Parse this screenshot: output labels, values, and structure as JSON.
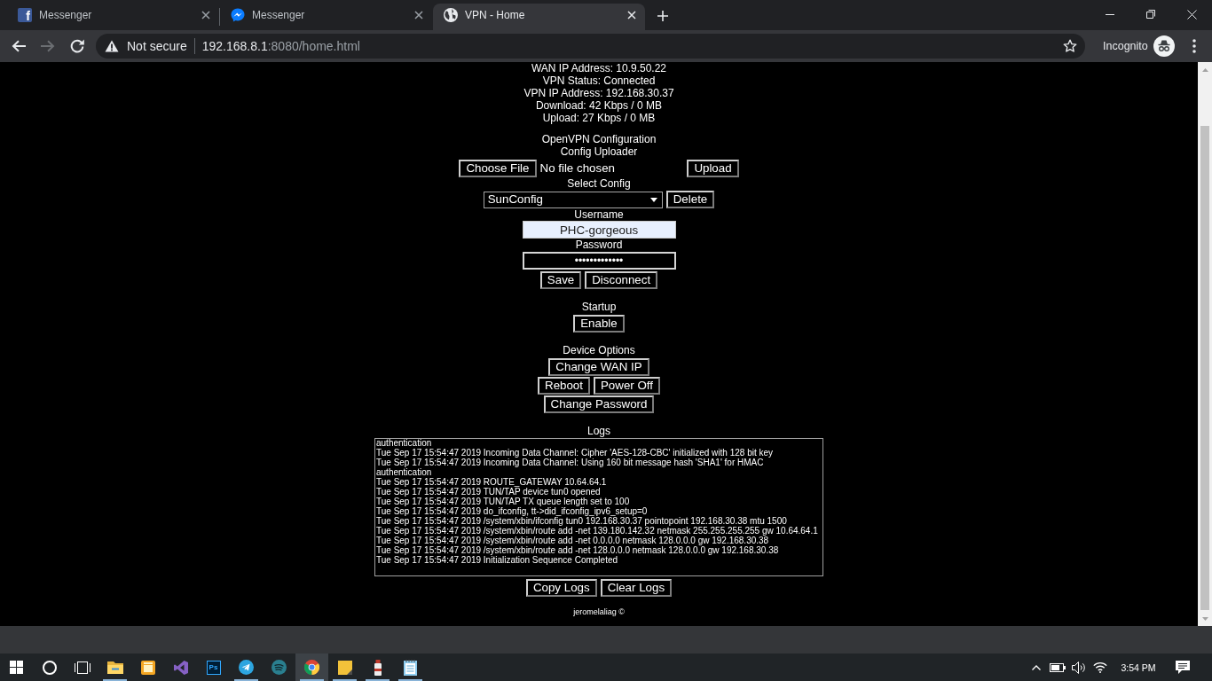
{
  "browser": {
    "tabs": [
      {
        "title": "Messenger",
        "kind": "letter",
        "icon_text": "f",
        "selected": false
      },
      {
        "title": "Messenger",
        "kind": "bubble",
        "selected": false
      },
      {
        "title": "VPN - Home",
        "kind": "globe",
        "selected": true
      }
    ],
    "nav_buttons": [
      {
        "kind": "back",
        "disabled": false
      },
      {
        "kind": "forward",
        "disabled": true
      },
      {
        "kind": "reload",
        "disabled": false
      }
    ],
    "address_bar": {
      "security_label": "Not secure",
      "url_host": "192.168.8.1",
      "url_rest": ":8080/home.html"
    },
    "profile_label": "Incognito"
  },
  "page": {
    "status_lines": [
      "WAN IP Address: 10.9.50.22",
      "VPN Status: Connected",
      "VPN IP Address: 192.168.30.37",
      "Download: 42 Kbps / 0 MB",
      "Upload: 27 Kbps / 0 MB"
    ],
    "config_title": "OpenVPN Configuration",
    "uploader_title": "Config Uploader",
    "choose_file_button": "Choose File",
    "file_status": "No file chosen",
    "upload_button": "Upload",
    "select_label": "Select Config",
    "select_value": "SunConfig",
    "delete_button": "Delete",
    "username_label": "Username",
    "username_value": "PHC-gorgeous",
    "password_label": "Password",
    "password_value": "•••••••••••••",
    "save_button": "Save",
    "disconnect_button": "Disconnect",
    "startup_label": "Startup",
    "startup_button": "Enable",
    "device_title": "Device Options",
    "device_button_rows": [
      [
        "Change WAN IP"
      ],
      [
        "Reboot",
        "Power Off"
      ],
      [
        "Change Password"
      ]
    ],
    "logs_label": "Logs",
    "log_lines": [
      "authentication",
      "Tue Sep 17 15:54:47 2019 Incoming Data Channel: Cipher 'AES-128-CBC' initialized with 128 bit key",
      "Tue Sep 17 15:54:47 2019 Incoming Data Channel: Using 160 bit message hash 'SHA1' for HMAC",
      "authentication",
      "Tue Sep 17 15:54:47 2019 ROUTE_GATEWAY 10.64.64.1",
      "Tue Sep 17 15:54:47 2019 TUN/TAP device tun0 opened",
      "Tue Sep 17 15:54:47 2019 TUN/TAP TX queue length set to 100",
      "Tue Sep 17 15:54:47 2019 do_ifconfig, tt->did_ifconfig_ipv6_setup=0",
      "Tue Sep 17 15:54:47 2019 /system/xbin/ifconfig tun0 192.168.30.37 pointopoint 192.168.30.38 mtu 1500",
      "Tue Sep 17 15:54:47 2019 /system/xbin/route add -net 139.180.142.32 netmask 255.255.255.255 gw 10.64.64.1",
      "Tue Sep 17 15:54:47 2019 /system/xbin/route add -net 0.0.0.0 netmask 128.0.0.0 gw 192.168.30.38",
      "Tue Sep 17 15:54:47 2019 /system/xbin/route add -net 128.0.0.0 netmask 128.0.0.0 gw 192.168.30.38",
      "Tue Sep 17 15:54:47 2019 Initialization Sequence Completed"
    ],
    "log_buttons": [
      "Copy Logs",
      "Clear Logs"
    ],
    "footer": "jeromelaliag ©"
  },
  "taskbar": {
    "shell_buttons": [
      {
        "kind": "start"
      },
      {
        "kind": "search"
      },
      {
        "kind": "taskview"
      }
    ],
    "apps": [
      {
        "kind": "explorer",
        "open": true,
        "selected": false
      },
      {
        "kind": "box",
        "open": false,
        "selected": false
      },
      {
        "kind": "ribbon",
        "open": false,
        "selected": false
      },
      {
        "kind": "tile",
        "label": "Ps",
        "open": false,
        "selected": false
      },
      {
        "kind": "plane",
        "open": true,
        "selected": false
      },
      {
        "kind": "waves",
        "open": false,
        "selected": false
      },
      {
        "kind": "browser",
        "open": true,
        "selected": true
      },
      {
        "kind": "note",
        "open": true,
        "selected": false
      },
      {
        "kind": "bottle",
        "open": true,
        "selected": false
      },
      {
        "kind": "notepad",
        "open": true,
        "selected": false
      }
    ],
    "tray_icons": [
      {
        "kind": "chevron"
      },
      {
        "kind": "battery"
      },
      {
        "kind": "speaker"
      },
      {
        "kind": "wifi"
      }
    ],
    "clock": "3:54 PM"
  }
}
